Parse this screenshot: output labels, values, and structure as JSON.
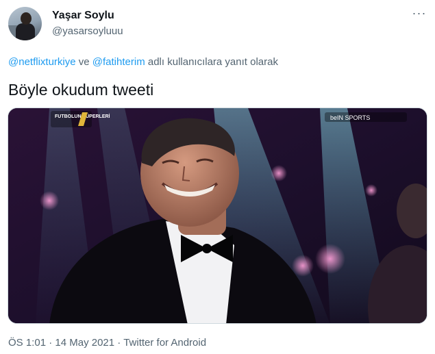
{
  "tweet": {
    "author_name": "Yaşar Soylu",
    "author_handle": "@yasarsoyluuu",
    "more_icon": "···",
    "reply_to_1": "@netflixturkiye",
    "reply_connector": " ve ",
    "reply_to_2": "@fatihterim",
    "reply_suffix": " adlı kullanıcılara yanıt olarak",
    "text": "Böyle okudum tweeti",
    "time": "ÖS 1:01",
    "separator": " · ",
    "date": "14 May 2021",
    "source": "Twitter for Android"
  },
  "media_overlay": {
    "broadcast_logo": "FUTBOLUN SÜPERLERİ",
    "channel_bug": "beIN SPORTS"
  },
  "colors": {
    "link": "#1d9bf0",
    "secondary_text": "#536471",
    "primary_text": "#0f1419"
  }
}
